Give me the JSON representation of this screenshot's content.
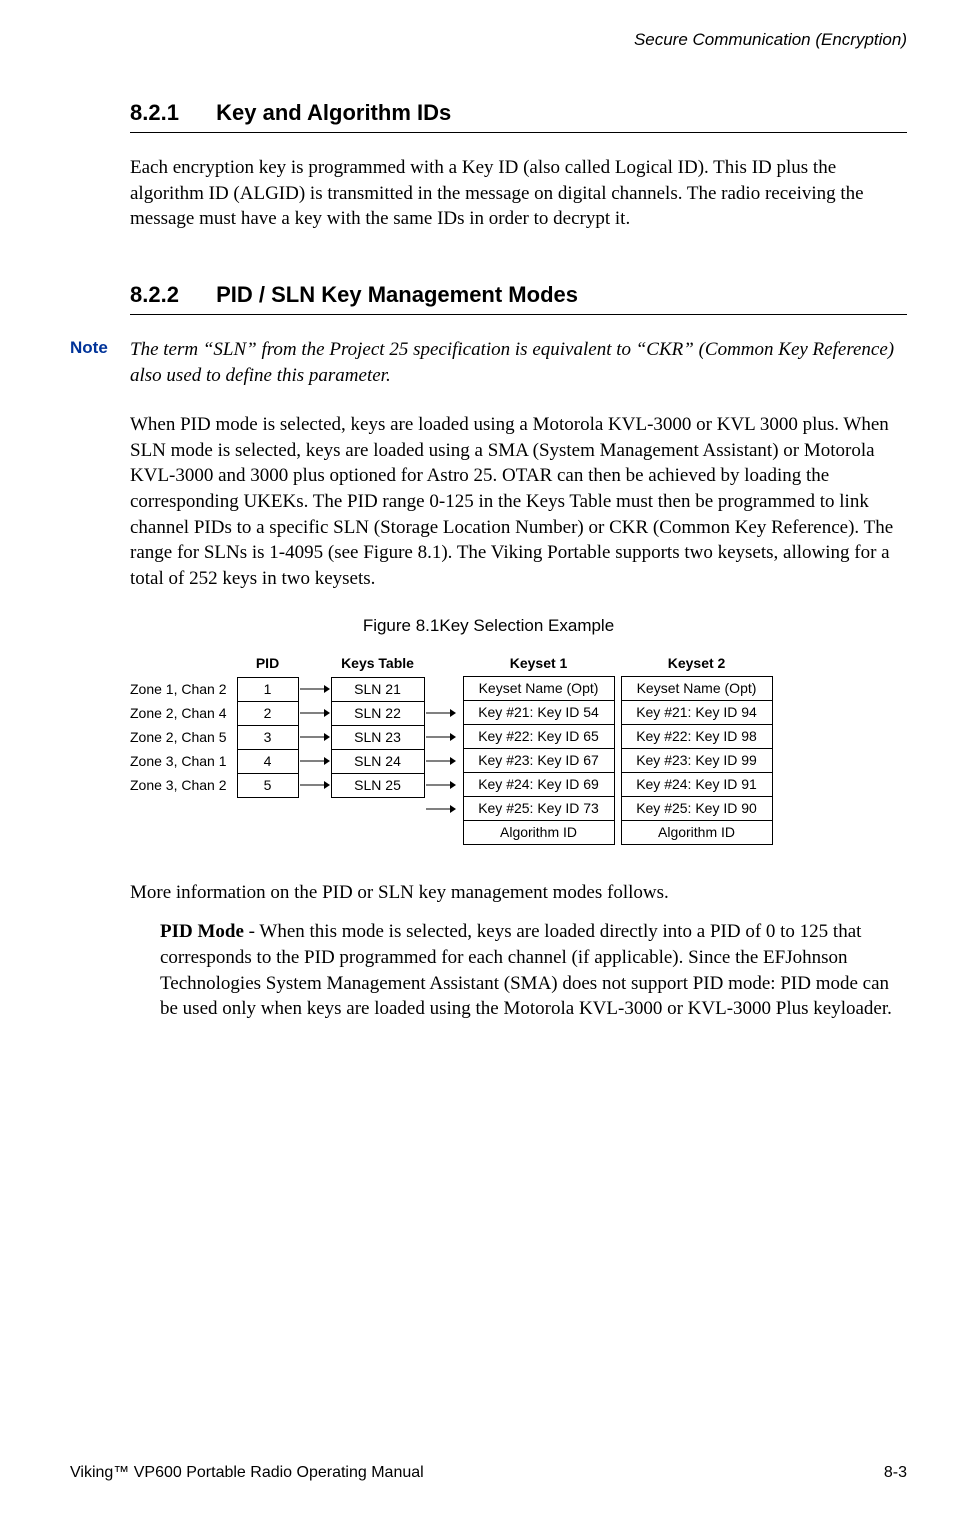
{
  "header": {
    "running": "Secure Communication (Encryption)"
  },
  "sections": {
    "s1": {
      "num": "8.2.1",
      "title": "Key and Algorithm IDs"
    },
    "s2": {
      "num": "8.2.2",
      "title": "PID / SLN Key Management Modes"
    }
  },
  "para1": "Each encryption key is programmed with a Key ID (also called Logical ID). This ID plus the algorithm ID (ALGID) is transmitted in the message on digital channels. The radio receiving the message must have a key with the same IDs in order to decrypt it.",
  "note": {
    "label": "Note",
    "text": "The term “SLN” from the Project 25 specification is equivalent to “CKR” (Common Key Reference) also used to define this parameter."
  },
  "para2": "When PID mode is selected, keys are loaded using a Motorola KVL-3000 or KVL 3000 plus. When SLN mode is selected, keys are loaded using a SMA (System Management Assistant) or Motorola KVL-3000 and 3000 plus optioned for Astro 25. OTAR can then be achieved by loading the corresponding UKEKs. The PID range 0-125 in the Keys Table must then be programmed to link channel PIDs to a specific SLN (Storage Location Number) or CKR (Common Key Reference). The range for SLNs is 1-4095 (see Figure 8.1). The Viking Portable supports two keysets, allowing for a total of 252 keys in two keysets.",
  "figure": {
    "caption": "Figure 8.1Key Selection Example",
    "zone_labels": [
      "Zone 1, Chan 2",
      "Zone 2, Chan 4",
      "Zone 2, Chan 5",
      "Zone 3, Chan 1",
      "Zone 3, Chan 2"
    ],
    "pid_header": "PID",
    "pids": [
      "1",
      "2",
      "3",
      "4",
      "5"
    ],
    "keys_header": "Keys Table",
    "keys": [
      "SLN 21",
      "SLN 22",
      "SLN 23",
      "SLN 24",
      "SLN 25"
    ],
    "keyset1": {
      "title": "Keyset 1",
      "rows": [
        "Keyset Name (Opt)",
        "Key #21: Key ID 54",
        "Key #22: Key ID 65",
        "Key #23: Key ID 67",
        "Key #24: Key ID 69",
        "Key #25: Key ID 73",
        "Algorithm ID"
      ]
    },
    "keyset2": {
      "title": "Keyset 2",
      "rows": [
        "Keyset Name (Opt)",
        "Key #21: Key ID 94",
        "Key #22: Key ID 98",
        "Key #23: Key ID 99",
        "Key #24: Key ID 91",
        "Key #25: Key ID 90",
        "Algorithm ID"
      ]
    }
  },
  "para3": "More information on the PID or SLN key management modes follows.",
  "para4": {
    "bold": "PID Mode",
    "rest": " - When this mode is selected, keys are loaded directly into a PID of 0 to 125 that corresponds to the PID programmed for each channel (if applicable). Since the EFJohnson Technologies System Management Assistant (SMA) does not support PID mode: PID mode can be used only when keys are loaded using the Motorola KVL-3000 or KVL-3000 Plus keyloader."
  },
  "footer": {
    "left": "Viking™ VP600 Portable Radio Operating Manual",
    "right": "8-3"
  }
}
